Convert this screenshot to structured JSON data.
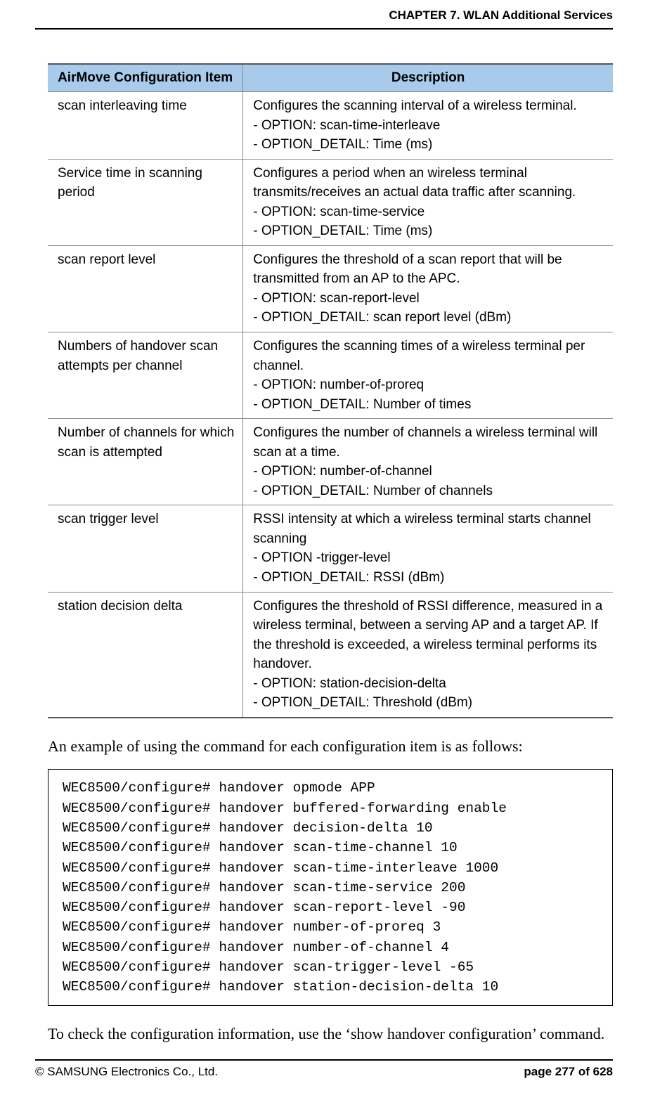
{
  "header": {
    "chapter": "CHAPTER 7. WLAN Additional Services"
  },
  "table": {
    "col1": "AirMove Configuration Item",
    "col2": "Description",
    "rows": [
      {
        "item": "scan interleaving time",
        "desc": "Configures the scanning interval of a wireless terminal.\n- OPTION: scan-time-interleave\n- OPTION_DETAIL: Time (ms)"
      },
      {
        "item": "Service time in scanning period",
        "desc": "Configures a period when an wireless terminal transmits/receives an actual data traffic after scanning.\n- OPTION: scan-time-service\n- OPTION_DETAIL: Time (ms)"
      },
      {
        "item": "scan report level",
        "desc": "Configures the threshold of a scan report that will be transmitted from an AP to the APC.\n- OPTION: scan-report-level\n- OPTION_DETAIL: scan report level (dBm)"
      },
      {
        "item": "Numbers of handover scan attempts per channel",
        "desc": "Configures the scanning times of a wireless terminal per channel.\n- OPTION: number-of-proreq\n- OPTION_DETAIL: Number of times"
      },
      {
        "item": "Number of channels for which scan is attempted",
        "desc": "Configures the number of channels a wireless terminal will scan at a time.\n- OPTION: number-of-channel\n- OPTION_DETAIL: Number of channels"
      },
      {
        "item": "scan trigger level",
        "desc": "RSSI intensity at which a wireless terminal starts channel scanning\n- OPTION -trigger-level\n- OPTION_DETAIL: RSSI (dBm)"
      },
      {
        "item": "station decision delta",
        "desc": "Configures the threshold of RSSI difference, measured in a wireless terminal, between a serving AP and a target AP. If the threshold is exceeded, a wireless terminal performs its handover.\n- OPTION: station-decision-delta\n- OPTION_DETAIL: Threshold (dBm)"
      }
    ]
  },
  "paragraph1": "An example of using the command for each configuration item is as follows:",
  "code": "WEC8500/configure# handover opmode APP\nWEC8500/configure# handover buffered-forwarding enable\nWEC8500/configure# handover decision-delta 10\nWEC8500/configure# handover scan-time-channel 10\nWEC8500/configure# handover scan-time-interleave 1000\nWEC8500/configure# handover scan-time-service 200\nWEC8500/configure# handover scan-report-level -90\nWEC8500/configure# handover number-of-proreq 3\nWEC8500/configure# handover number-of-channel 4\nWEC8500/configure# handover scan-trigger-level -65\nWEC8500/configure# handover station-decision-delta 10",
  "paragraph2": "To check the configuration information, use the ‘show handover configuration’ command.",
  "footer": {
    "left": "© SAMSUNG Electronics Co., Ltd.",
    "right": "page 277 of 628"
  }
}
